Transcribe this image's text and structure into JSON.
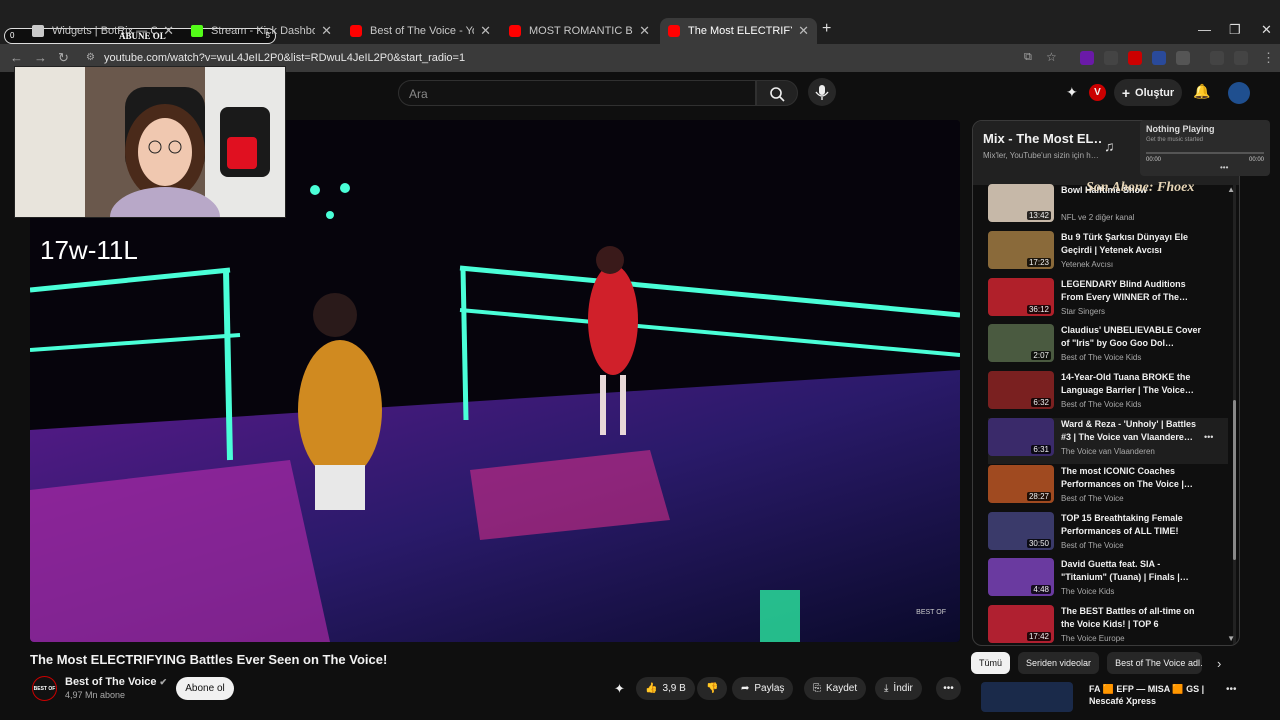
{
  "browser": {
    "tabs": [
      {
        "label": "Widgets | BotRix — Cloud Stre…",
        "favicon_color": "#c9c9c9",
        "active": false
      },
      {
        "label": "Stream - Kick Dashboard",
        "favicon_color": "#53fc18",
        "active": false
      },
      {
        "label": "Best of The Voice - YouTube",
        "favicon_color": "#ff0000",
        "active": false
      },
      {
        "label": "MOST ROMANTIC Boy/Girl Du…",
        "favicon_color": "#ff0000",
        "active": false
      },
      {
        "label": "The Most ELECTRIFYING Battles…",
        "favicon_color": "#ff0000",
        "active": true
      }
    ],
    "overlay_label": "ABUNE OL",
    "overlay_left": "0",
    "overlay_right": "5",
    "url": "youtube.com/watch?v=wuL4JeIL2P0&list=RDwuL4JeIL2P0&start_radio=1"
  },
  "youtube": {
    "search_placeholder": "Ara",
    "create_label": "Oluştur",
    "video": {
      "overlay_score": "17w-11L",
      "title": "The Most ELECTRIFYING Battles Ever Seen on The Voice!",
      "channel": "Best of The Voice",
      "channel_avatar_text": "BEST OF",
      "subscribers": "4,97 Mn abone",
      "subscribe_label": "Abone ol",
      "likes": "3,9 B",
      "share_label": "Paylaş",
      "save_label": "Kaydet",
      "download_label": "İndir"
    },
    "mix": {
      "title": "Mix - The Most EL…",
      "subtitle": "Mix'ler, YouTube'un sizin için h…"
    },
    "now_playing": {
      "title": "Nothing Playing",
      "subtitle": "Get the music started",
      "time_start": "00:00",
      "time_end": "00:00"
    },
    "bowl_overlay": "Son Abone: Fhoex",
    "playlist": [
      {
        "title": "Bowl Halftime Show",
        "channel": "NFL ve 2 diğer kanal",
        "duration": "13:42",
        "color": "#c6b8a8"
      },
      {
        "title": "Bu 9 Türk Şarkısı Dünyayı Ele Geçirdi | Yetenek Avcısı",
        "channel": "Yetenek Avcısı",
        "duration": "17:23",
        "color": "#8a6a3a"
      },
      {
        "title": "LEGENDARY Blind Auditions From Every WINNER of The…",
        "channel": "Star Singers",
        "duration": "36:12",
        "color": "#b0202a"
      },
      {
        "title": "Claudius' UNBELIEVABLE Cover of \"Iris\" by Goo Goo Dol…",
        "channel": "Best of The Voice Kids",
        "duration": "2:07",
        "color": "#4a5a40"
      },
      {
        "title": "14-Year-Old Tuana BROKE the Language Barrier | The Voice…",
        "channel": "Best of The Voice Kids",
        "duration": "6:32",
        "color": "#7a2020"
      },
      {
        "title": "Ward & Reza - 'Unholy' | Battles #3 | The Voice van Vlaandere…",
        "channel": "The Voice van Vlaanderen",
        "duration": "6:31",
        "color": "#3a2a6a"
      },
      {
        "title": "The most ICONIC Coaches Performances on The Voice |…",
        "channel": "Best of The Voice",
        "duration": "28:27",
        "color": "#a04a20"
      },
      {
        "title": "TOP 15 Breathtaking Female Performances of ALL TIME!",
        "channel": "Best of The Voice",
        "duration": "30:50",
        "color": "#3a3a6a"
      },
      {
        "title": "David Guetta feat. SIA - \"Titanium\" (Tuana) | Finals |…",
        "channel": "The Voice Kids",
        "duration": "4:48",
        "color": "#6a3aa0"
      },
      {
        "title": "The BEST Battles of all-time on the Voice Kids! | TOP 6",
        "channel": "The Voice Europe",
        "duration": "17:42",
        "color": "#b02030"
      }
    ],
    "chips": [
      "Tümü",
      "Seriden videolar",
      "Best of The Voice adl…"
    ],
    "up_next_partial": "FA 🟧 EFP — MISA 🟧 GS | Nescafé Xpress Challengers…",
    "colors": {
      "background": "#0f0f0f",
      "accent": "#ff0000",
      "chip_selected": "#f1f1f1"
    }
  }
}
